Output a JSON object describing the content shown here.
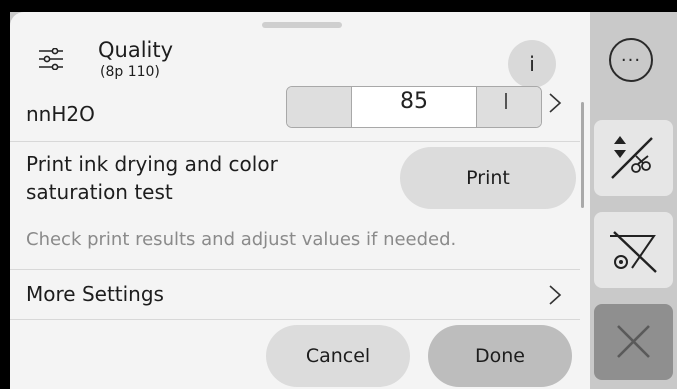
{
  "header": {
    "title": "Quality",
    "subtitle": "(8p 110)",
    "info_label": "i",
    "settings_icon": "settings-sliders-icon"
  },
  "rows": {
    "nnh2o": {
      "label": "nnH2O",
      "value": "85"
    },
    "print_test": {
      "label": "Print ink drying and color saturation test",
      "button_label": "Print"
    },
    "hint": "Check print results and adjust values if needed.",
    "more_settings": {
      "label": "More Settings"
    }
  },
  "footer": {
    "cancel_label": "Cancel",
    "done_label": "Done"
  },
  "side_bar": {
    "more_label": "···",
    "icons": [
      "more-options-icon",
      "cut-adjust-icon",
      "no-cut-icon",
      "close-icon"
    ]
  },
  "colors": {
    "panel_bg": "#f4f4f4",
    "side_bg": "#c9c9c9",
    "button_bg": "#dcdcdc",
    "done_bg": "#bdbdbd",
    "close_bg": "#8f8f8f"
  }
}
